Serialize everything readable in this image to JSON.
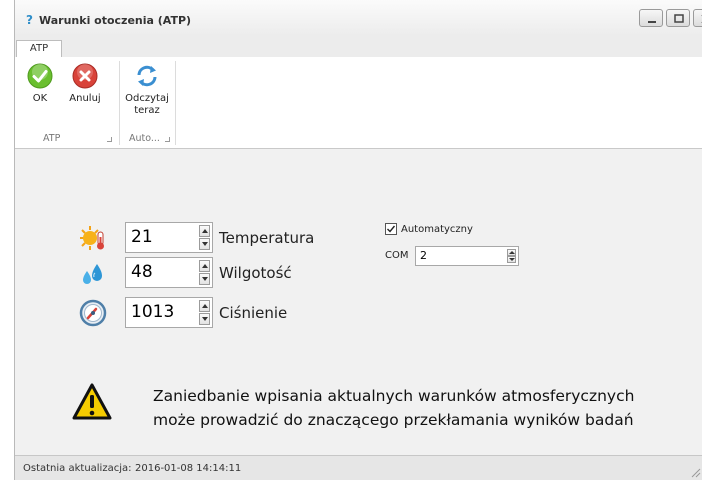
{
  "window": {
    "title": "Warunki otoczenia (ATP)",
    "icon": "app-help-icon",
    "controls": [
      "minimize-icon",
      "maximize-icon",
      "close-icon"
    ]
  },
  "ribbon": {
    "tabs": [
      {
        "label": "ATP"
      }
    ],
    "groups": [
      {
        "label": "ATP",
        "buttons": [
          {
            "label": "OK",
            "icon": "check-icon",
            "color": "#6abf2f"
          },
          {
            "label": "Anuluj",
            "icon": "cancel-icon",
            "color": "#d9433a"
          }
        ]
      },
      {
        "label": "Auto...",
        "buttons": [
          {
            "label": "Odczytaj teraz",
            "line1": "Odczytaj",
            "line2": "teraz",
            "icon": "refresh-icon",
            "color": "#3b8fd1"
          }
        ]
      }
    ]
  },
  "fields": [
    {
      "label": "Temperatura",
      "value": "21",
      "icon": "sun-thermometer-icon"
    },
    {
      "label": "Wilgotość",
      "value": "48",
      "icon": "water-drops-icon"
    },
    {
      "label": "Ciśnienie",
      "value": "1013",
      "icon": "gauge-icon"
    }
  ],
  "auto": {
    "label": "Automatyczny",
    "checked": true
  },
  "com": {
    "label": "COM",
    "value": "2"
  },
  "warning": {
    "line1": "Zaniedbanie wpisania aktualnych warunków atmosferycznych",
    "line2": "może prowadzić do znaczącego przekłamania wyników badań",
    "icon": "warning-icon",
    "color": "#f5cc00"
  },
  "status": {
    "label": "Ostatnia aktualizacja:",
    "value": "2016-01-08 14:14:11"
  }
}
